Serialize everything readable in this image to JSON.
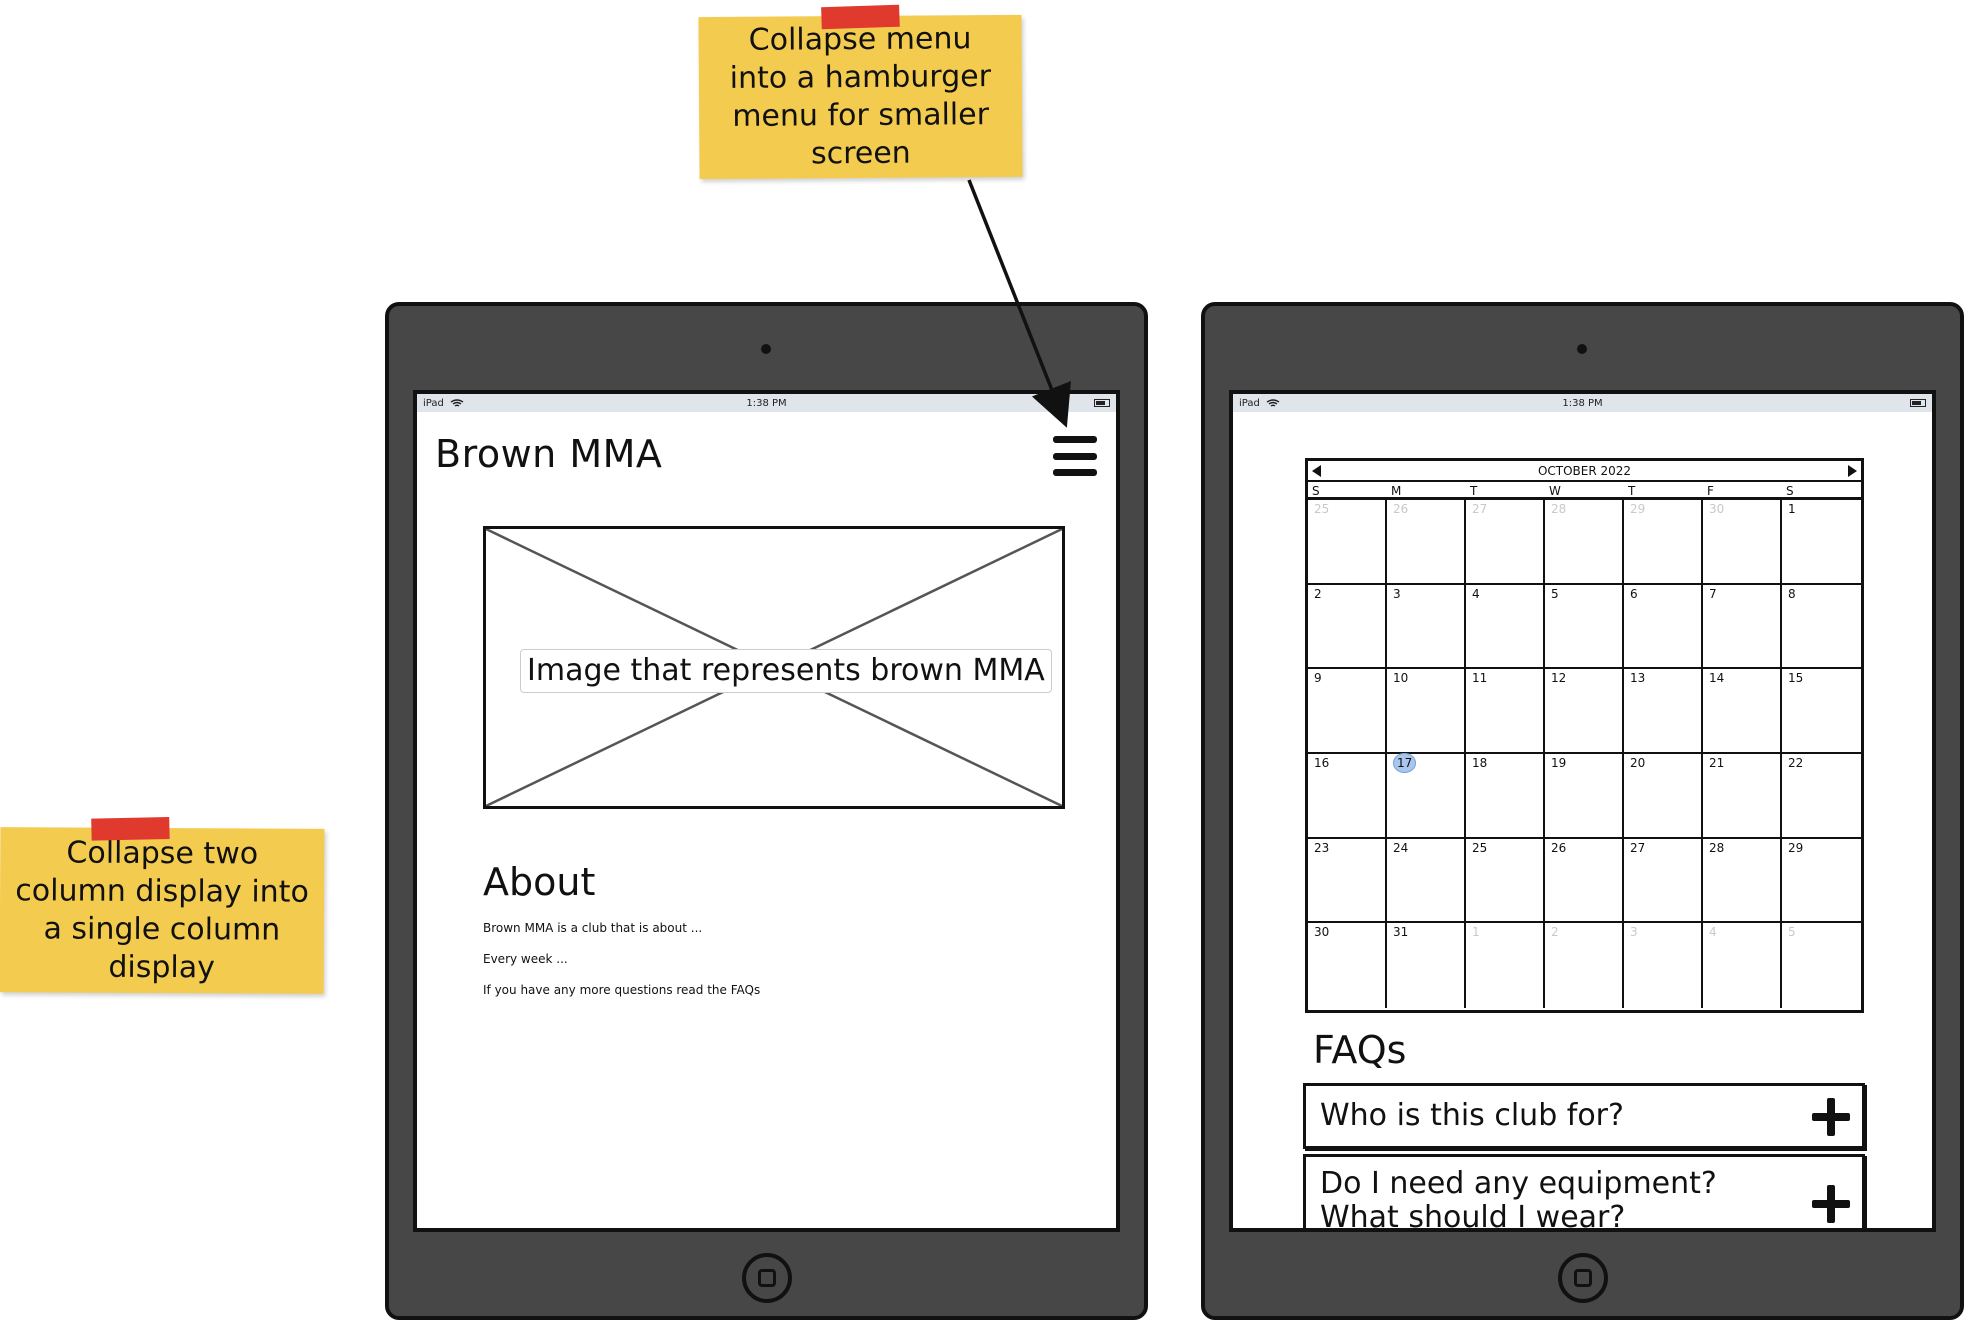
{
  "notes": {
    "menu": "Collapse menu into a hamburger menu for smaller screen",
    "columns": "Collapse two column display into a single column display"
  },
  "statusbar": {
    "device": "iPad",
    "time": "1:38 PM"
  },
  "left_screen": {
    "site_title": "Brown MMA",
    "hero_placeholder": "Image that represents brown MMA",
    "about_heading": "About",
    "about_paragraphs": [
      "Brown MMA is a club that is about ...",
      "Every week ...",
      "If you have any more questions read the FAQs"
    ]
  },
  "right_screen": {
    "calendar": {
      "month": "OCTOBER 2022",
      "weekdays": [
        "S",
        "M",
        "T",
        "W",
        "T",
        "F",
        "S"
      ],
      "days": [
        {
          "d": "25",
          "muted": true
        },
        {
          "d": "26",
          "muted": true
        },
        {
          "d": "27",
          "muted": true
        },
        {
          "d": "28",
          "muted": true
        },
        {
          "d": "29",
          "muted": true
        },
        {
          "d": "30",
          "muted": true
        },
        {
          "d": "1"
        },
        {
          "d": "2"
        },
        {
          "d": "3"
        },
        {
          "d": "4"
        },
        {
          "d": "5"
        },
        {
          "d": "6"
        },
        {
          "d": "7"
        },
        {
          "d": "8"
        },
        {
          "d": "9"
        },
        {
          "d": "10"
        },
        {
          "d": "11"
        },
        {
          "d": "12"
        },
        {
          "d": "13"
        },
        {
          "d": "14"
        },
        {
          "d": "15"
        },
        {
          "d": "16"
        },
        {
          "d": "17",
          "today": true
        },
        {
          "d": "18"
        },
        {
          "d": "19"
        },
        {
          "d": "20"
        },
        {
          "d": "21"
        },
        {
          "d": "22"
        },
        {
          "d": "23"
        },
        {
          "d": "24"
        },
        {
          "d": "25"
        },
        {
          "d": "26"
        },
        {
          "d": "27"
        },
        {
          "d": "28"
        },
        {
          "d": "29"
        },
        {
          "d": "30"
        },
        {
          "d": "31"
        },
        {
          "d": "1",
          "muted": true
        },
        {
          "d": "2",
          "muted": true
        },
        {
          "d": "3",
          "muted": true
        },
        {
          "d": "4",
          "muted": true
        },
        {
          "d": "5",
          "muted": true
        }
      ]
    },
    "faq_heading": "FAQs",
    "faqs": [
      "Who is this club for?",
      "Do I need any equipment? What should I wear?"
    ]
  },
  "colors": {
    "note": "#f3cb4f",
    "tape": "#e0392e",
    "device": "#474747",
    "today": "#a9c6ec"
  }
}
